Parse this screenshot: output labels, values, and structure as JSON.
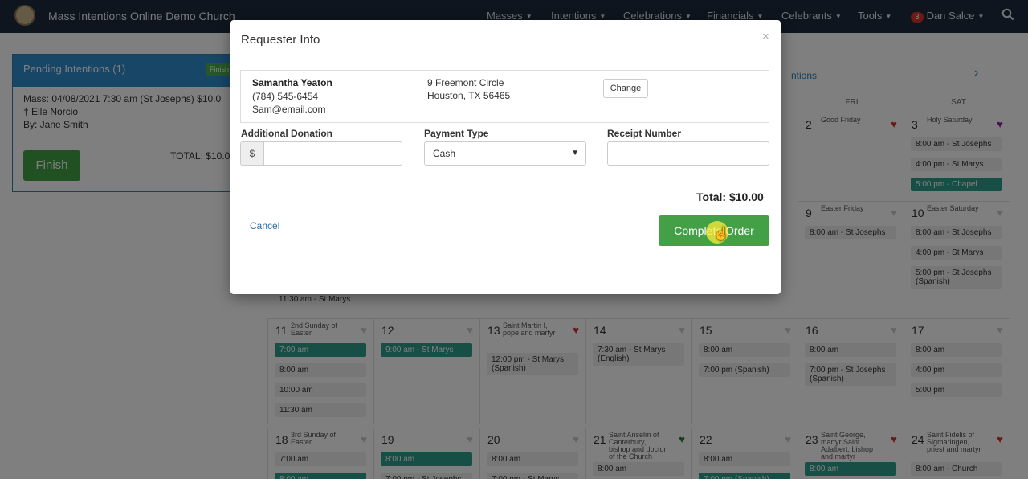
{
  "navbar": {
    "brand": "Mass Intentions Online Demo Church",
    "menu": [
      {
        "label": "Masses"
      },
      {
        "label": "Intentions"
      },
      {
        "label": "Celebrations"
      },
      {
        "label": "Financials"
      },
      {
        "label": "Celebrants"
      },
      {
        "label": "Tools"
      }
    ],
    "notification_count": "3",
    "user": "Dan Salce"
  },
  "pending": {
    "title": "Pending Intentions (1)",
    "finish_tag": "Finish",
    "line1": "Mass: 04/08/2021 7:30 am (St Josephs)",
    "line1_amount": "$10.0",
    "line2": "† Elle Norcio",
    "line3": "By: Jane Smith",
    "finish_button": "Finish",
    "total": "TOTAL: $10.0"
  },
  "calendar": {
    "title_fragment": "ntions",
    "next": "›",
    "days_of_week": [
      "FRI",
      "SAT"
    ],
    "cells": [
      {
        "day": "2",
        "feast": "Good Friday",
        "heart": "red",
        "events": []
      },
      {
        "day": "3",
        "feast": "Holy Saturday",
        "heart": "purple",
        "events": [
          {
            "text": "8:00 am - St Josephs"
          },
          {
            "text": "4:00 pm - St Marys"
          },
          {
            "text": "5:00 pm - Chapel",
            "teal": true
          }
        ]
      },
      {
        "day": "9",
        "feast": "Easter Friday",
        "heart": "",
        "events": [
          {
            "text": "8:00 am - St Josephs"
          }
        ]
      },
      {
        "day": "10",
        "feast": "Easter Saturday",
        "heart": "",
        "events": [
          {
            "text": "8:00 am - St Josephs"
          },
          {
            "text": "4:00 pm - St Marys"
          },
          {
            "text": "5:00 pm - St Josephs (Spanish)"
          }
        ]
      },
      {
        "day": "11",
        "feast": "2nd Sunday of Easter",
        "heart": "",
        "events": [
          {
            "text": "7:00 am",
            "teal": true
          },
          {
            "text": "8:00 am"
          },
          {
            "text": "10:00 am"
          },
          {
            "text": "11:30 am"
          }
        ]
      },
      {
        "day": "12",
        "feast": "",
        "heart": "",
        "events": [
          {
            "text": "9:00 am - St Marys",
            "teal": true
          }
        ]
      },
      {
        "day": "13",
        "feast": "Saint Martin I, pope and martyr",
        "heart": "red",
        "events": [
          {
            "text": "12:00 pm - St Marys (Spanish)"
          }
        ]
      },
      {
        "day": "14",
        "feast": "",
        "heart": "",
        "events": [
          {
            "text": "7:30 am - St Marys (English)"
          }
        ]
      },
      {
        "day": "15",
        "feast": "",
        "heart": "",
        "events": [
          {
            "text": "8:00 am"
          },
          {
            "text": "7:00 pm (Spanish)"
          }
        ]
      },
      {
        "day": "16",
        "feast": "",
        "heart": "",
        "events": [
          {
            "text": "8:00 am"
          },
          {
            "text": "7:00 pm - St Josephs (Spanish)"
          }
        ]
      },
      {
        "day": "17",
        "feast": "",
        "heart": "",
        "events": [
          {
            "text": "8:00 am"
          },
          {
            "text": "4:00 pm"
          },
          {
            "text": "5:00 pm"
          }
        ]
      },
      {
        "day": "18",
        "feast": "3rd Sunday of Easter",
        "heart": "",
        "events": [
          {
            "text": "7:00 am"
          },
          {
            "text": "8:00 am",
            "teal": true
          }
        ]
      },
      {
        "day": "19",
        "feast": "",
        "heart": "",
        "events": [
          {
            "text": "8:00 am",
            "teal": true
          },
          {
            "text": "7:00 pm - St Josephs"
          }
        ]
      },
      {
        "day": "20",
        "feast": "",
        "heart": "",
        "events": [
          {
            "text": "8:00 am"
          },
          {
            "text": "7:00 pm - St Marys"
          }
        ]
      },
      {
        "day": "21",
        "feast": "Saint Anselm of Canterbury, bishop and doctor of the Church",
        "heart": "green",
        "events": [
          {
            "text": "8:00 am"
          }
        ]
      },
      {
        "day": "22",
        "feast": "",
        "heart": "",
        "events": [
          {
            "text": "8:00 am"
          },
          {
            "text": "7:00 pm (Spanish)",
            "teal": true
          }
        ]
      },
      {
        "day": "23",
        "feast": "Saint George, martyr Saint Adalbert, bishop and martyr",
        "heart": "red",
        "events": [
          {
            "text": "8:00 am",
            "teal": true
          }
        ]
      },
      {
        "day": "24",
        "feast": "Saint Fidelis of Sigmaringen, priest and martyr",
        "heart": "red",
        "events": [
          {
            "text": "8:00 am - Church"
          }
        ]
      }
    ],
    "row_fragment": "11:30 am - St Marys"
  },
  "modal": {
    "title": "Requester Info",
    "close": "×",
    "requester": {
      "name": "Samantha Yeaton",
      "phone": "(784) 545-6454",
      "email": "Sam@email.com",
      "address1": "9 Freemont Circle",
      "address2": "Houston, TX 56465"
    },
    "change_button": "Change",
    "additional_donation": {
      "label": "Additional Donation",
      "prefix": "$",
      "value": ""
    },
    "payment_type": {
      "label": "Payment Type",
      "selected": "Cash"
    },
    "receipt_number": {
      "label": "Receipt Number",
      "value": ""
    },
    "total": "Total: $10.00",
    "cancel": "Cancel",
    "complete_button": "Complete Order"
  },
  "colors": {
    "navbar": "#1f2a3c",
    "primary": "#2f8ccd",
    "success": "#43a047",
    "teal_event": "#2e9e8c"
  }
}
